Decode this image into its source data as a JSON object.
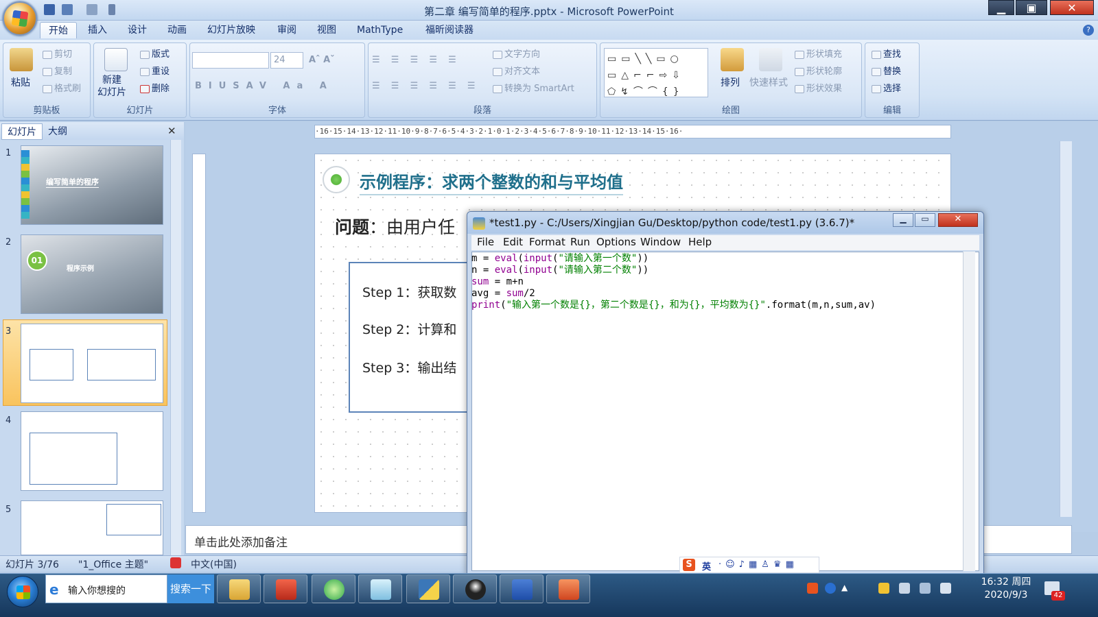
{
  "window": {
    "title": "第二章 编写简单的程序.pptx - Microsoft PowerPoint",
    "min": "▁",
    "max": "▣",
    "close": "✕"
  },
  "ribbon_tabs": [
    "开始",
    "插入",
    "设计",
    "动画",
    "幻灯片放映",
    "审阅",
    "视图",
    "MathType",
    "福昕阅读器"
  ],
  "clipboard": {
    "label": "剪贴板",
    "paste": "粘贴",
    "cut": "剪切",
    "copy": "复制",
    "format_painter": "格式刷"
  },
  "slides_group": {
    "label": "幻灯片",
    "new_slide": "新建\n幻灯片",
    "layout": "版式",
    "reset": "重设",
    "delete": "删除"
  },
  "font_group": {
    "label": "字体",
    "size": "24"
  },
  "paragraph_group": {
    "label": "段落",
    "text_direction": "文字方向",
    "align_text": "对齐文本",
    "smartart": "转换为 SmartArt"
  },
  "drawing_group": {
    "label": "绘图",
    "arrange": "排列",
    "quick_styles": "快速样式",
    "shape_fill": "形状填充",
    "shape_outline": "形状轮廓",
    "shape_effects": "形状效果"
  },
  "editing_group": {
    "label": "编辑",
    "find": "查找",
    "replace": "替换",
    "select": "选择"
  },
  "left_pane": {
    "tab_slides": "幻灯片",
    "tab_outline": "大纲",
    "close": "✕",
    "slide_numbers": [
      "1",
      "2",
      "3",
      "4",
      "5"
    ],
    "thumb1_title": "编写简单的程序",
    "thumb2_num": "01",
    "thumb2_title": "程序示例"
  },
  "ruler": {
    "h": "·16·15·14·13·12·11·10·9·8·7·6·5·4·3·2·1·0·1·2·3·4·5·6·7·8·9·10·11·12·13·14·15·16·"
  },
  "slide": {
    "title": "示例程序：求两个整数的和与平均值",
    "question_bold": "问题",
    "question_rest": "：由用户任",
    "steps": [
      "Step 1：获取数",
      "Step 2：计算和",
      "Step 3：输出结"
    ]
  },
  "notes_placeholder": "单击此处添加备注",
  "status": {
    "slide": "幻灯片 3/76",
    "theme": "\"1_Office 主题\"",
    "lang": "中文(中国)"
  },
  "idle": {
    "title": "*test1.py - C:/Users/Xingjian Gu/Desktop/python code/test1.py (3.6.7)*",
    "menu": [
      "File",
      "Edit",
      "Format",
      "Run",
      "Options",
      "Window",
      "Help"
    ],
    "code": [
      {
        "a": "m = ",
        "b": "eval",
        "c": "(",
        "d": "input",
        "e": "(",
        "s": "\"请输入第一个数\"",
        "f": "))"
      },
      {
        "a": "n = ",
        "b": "eval",
        "c": "(",
        "d": "input",
        "e": "(",
        "s": "\"请输入第二个数\"",
        "f": "))"
      },
      {
        "a": "",
        "b": "sum",
        "c": " = m+n",
        "d": "",
        "e": "",
        "s": "",
        "f": ""
      },
      {
        "a": "avg = ",
        "b": "sum",
        "c": "/2",
        "d": "",
        "e": "",
        "s": "",
        "f": ""
      },
      {
        "a": "",
        "b": "print",
        "c": "(",
        "d": "",
        "e": "",
        "s": "\"输入第一个数是{}，第二个数是{}，和为{}，平均数为{}\"",
        "f": ".format(m,n,sum,av)"
      }
    ]
  },
  "ime": {
    "lang": "英"
  },
  "taskbar": {
    "search_placeholder": "输入你想搜的",
    "search_btn": "搜索一下",
    "time": "16:32 周四",
    "date": "2020/9/3",
    "badge": "42"
  }
}
